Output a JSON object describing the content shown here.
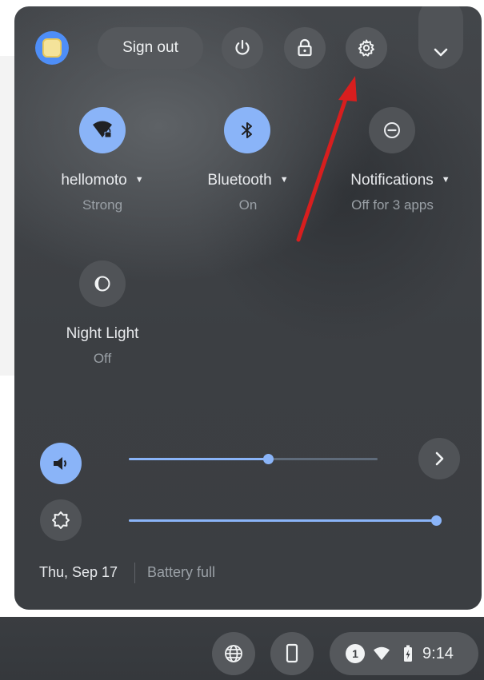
{
  "header": {
    "sign_out_label": "Sign out",
    "icons": {
      "avatar": "user-avatar",
      "power": "power-icon",
      "lock": "lock-icon",
      "settings": "gear-icon",
      "collapse": "chevron-down-icon"
    }
  },
  "tiles": [
    {
      "label": "hellomoto",
      "sub": "Strong",
      "icon": "wifi-icon",
      "active": true
    },
    {
      "label": "Bluetooth",
      "sub": "On",
      "icon": "bluetooth-icon",
      "active": true
    },
    {
      "label": "Notifications",
      "sub": "Off for 3 apps",
      "icon": "do-not-disturb-icon",
      "active": false
    },
    {
      "label": "Night Light",
      "sub": "Off",
      "icon": "night-light-icon",
      "active": false
    }
  ],
  "sliders": {
    "volume_level": 0.56,
    "brightness_level": 1.0
  },
  "footer": {
    "date": "Thu, Sep 17",
    "battery": "Battery full"
  },
  "shelf": {
    "notification_count": "1",
    "time": "9:14"
  },
  "colors": {
    "accent": "#8ab4f8",
    "panel": "#3c3f43",
    "annotation_arrow": "#d81e1e"
  }
}
